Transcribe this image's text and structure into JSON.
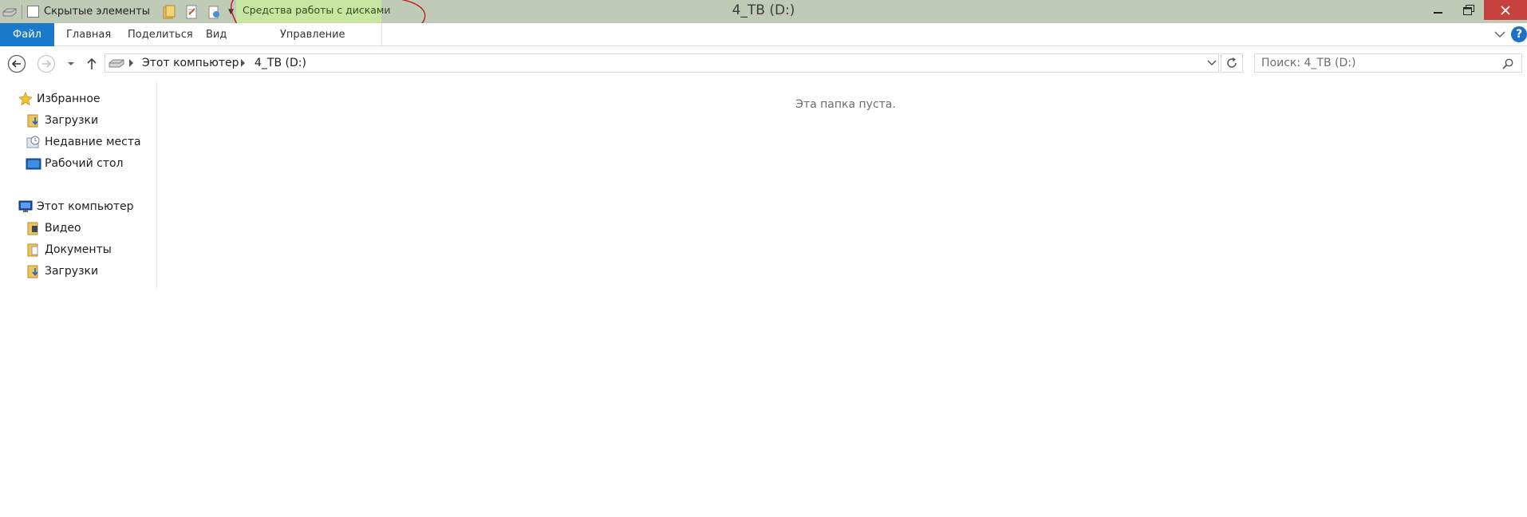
{
  "window": {
    "title": "4_TB (D:)"
  },
  "quick_access": {
    "hidden_items_label": "Скрытые элементы",
    "icons": [
      "drive-icon",
      "folder-icon",
      "properties-icon",
      "new-item-icon",
      "customize-dropdown-icon"
    ]
  },
  "context_tab": {
    "label": "Средства работы с дисками",
    "color": "#c6e6a2"
  },
  "ribbon": {
    "file": "Файл",
    "home": "Главная",
    "share": "Поделиться",
    "view": "Вид",
    "manage": "Управление",
    "file_color": "#1979ca"
  },
  "address": {
    "crumbs": [
      "Этот компьютер",
      "4_TB (D:)"
    ]
  },
  "search": {
    "placeholder": "Поиск: 4_TB (D:)"
  },
  "navpane": {
    "favorites": {
      "label": "Избранное",
      "items": [
        {
          "label": "Загрузки",
          "icon": "downloads-icon"
        },
        {
          "label": "Недавние места",
          "icon": "recent-places-icon"
        },
        {
          "label": "Рабочий стол",
          "icon": "desktop-icon"
        }
      ]
    },
    "computer": {
      "label": "Этот компьютер",
      "items": [
        {
          "label": "Видео",
          "icon": "videos-icon"
        },
        {
          "label": "Документы",
          "icon": "documents-icon"
        },
        {
          "label": "Загрузки",
          "icon": "downloads-icon"
        }
      ]
    }
  },
  "content": {
    "empty_message": "Эта папка пуста."
  },
  "colors": {
    "titlebar": "#bfcbb6",
    "close": "#c7413f",
    "annotation": "#c0161a"
  }
}
